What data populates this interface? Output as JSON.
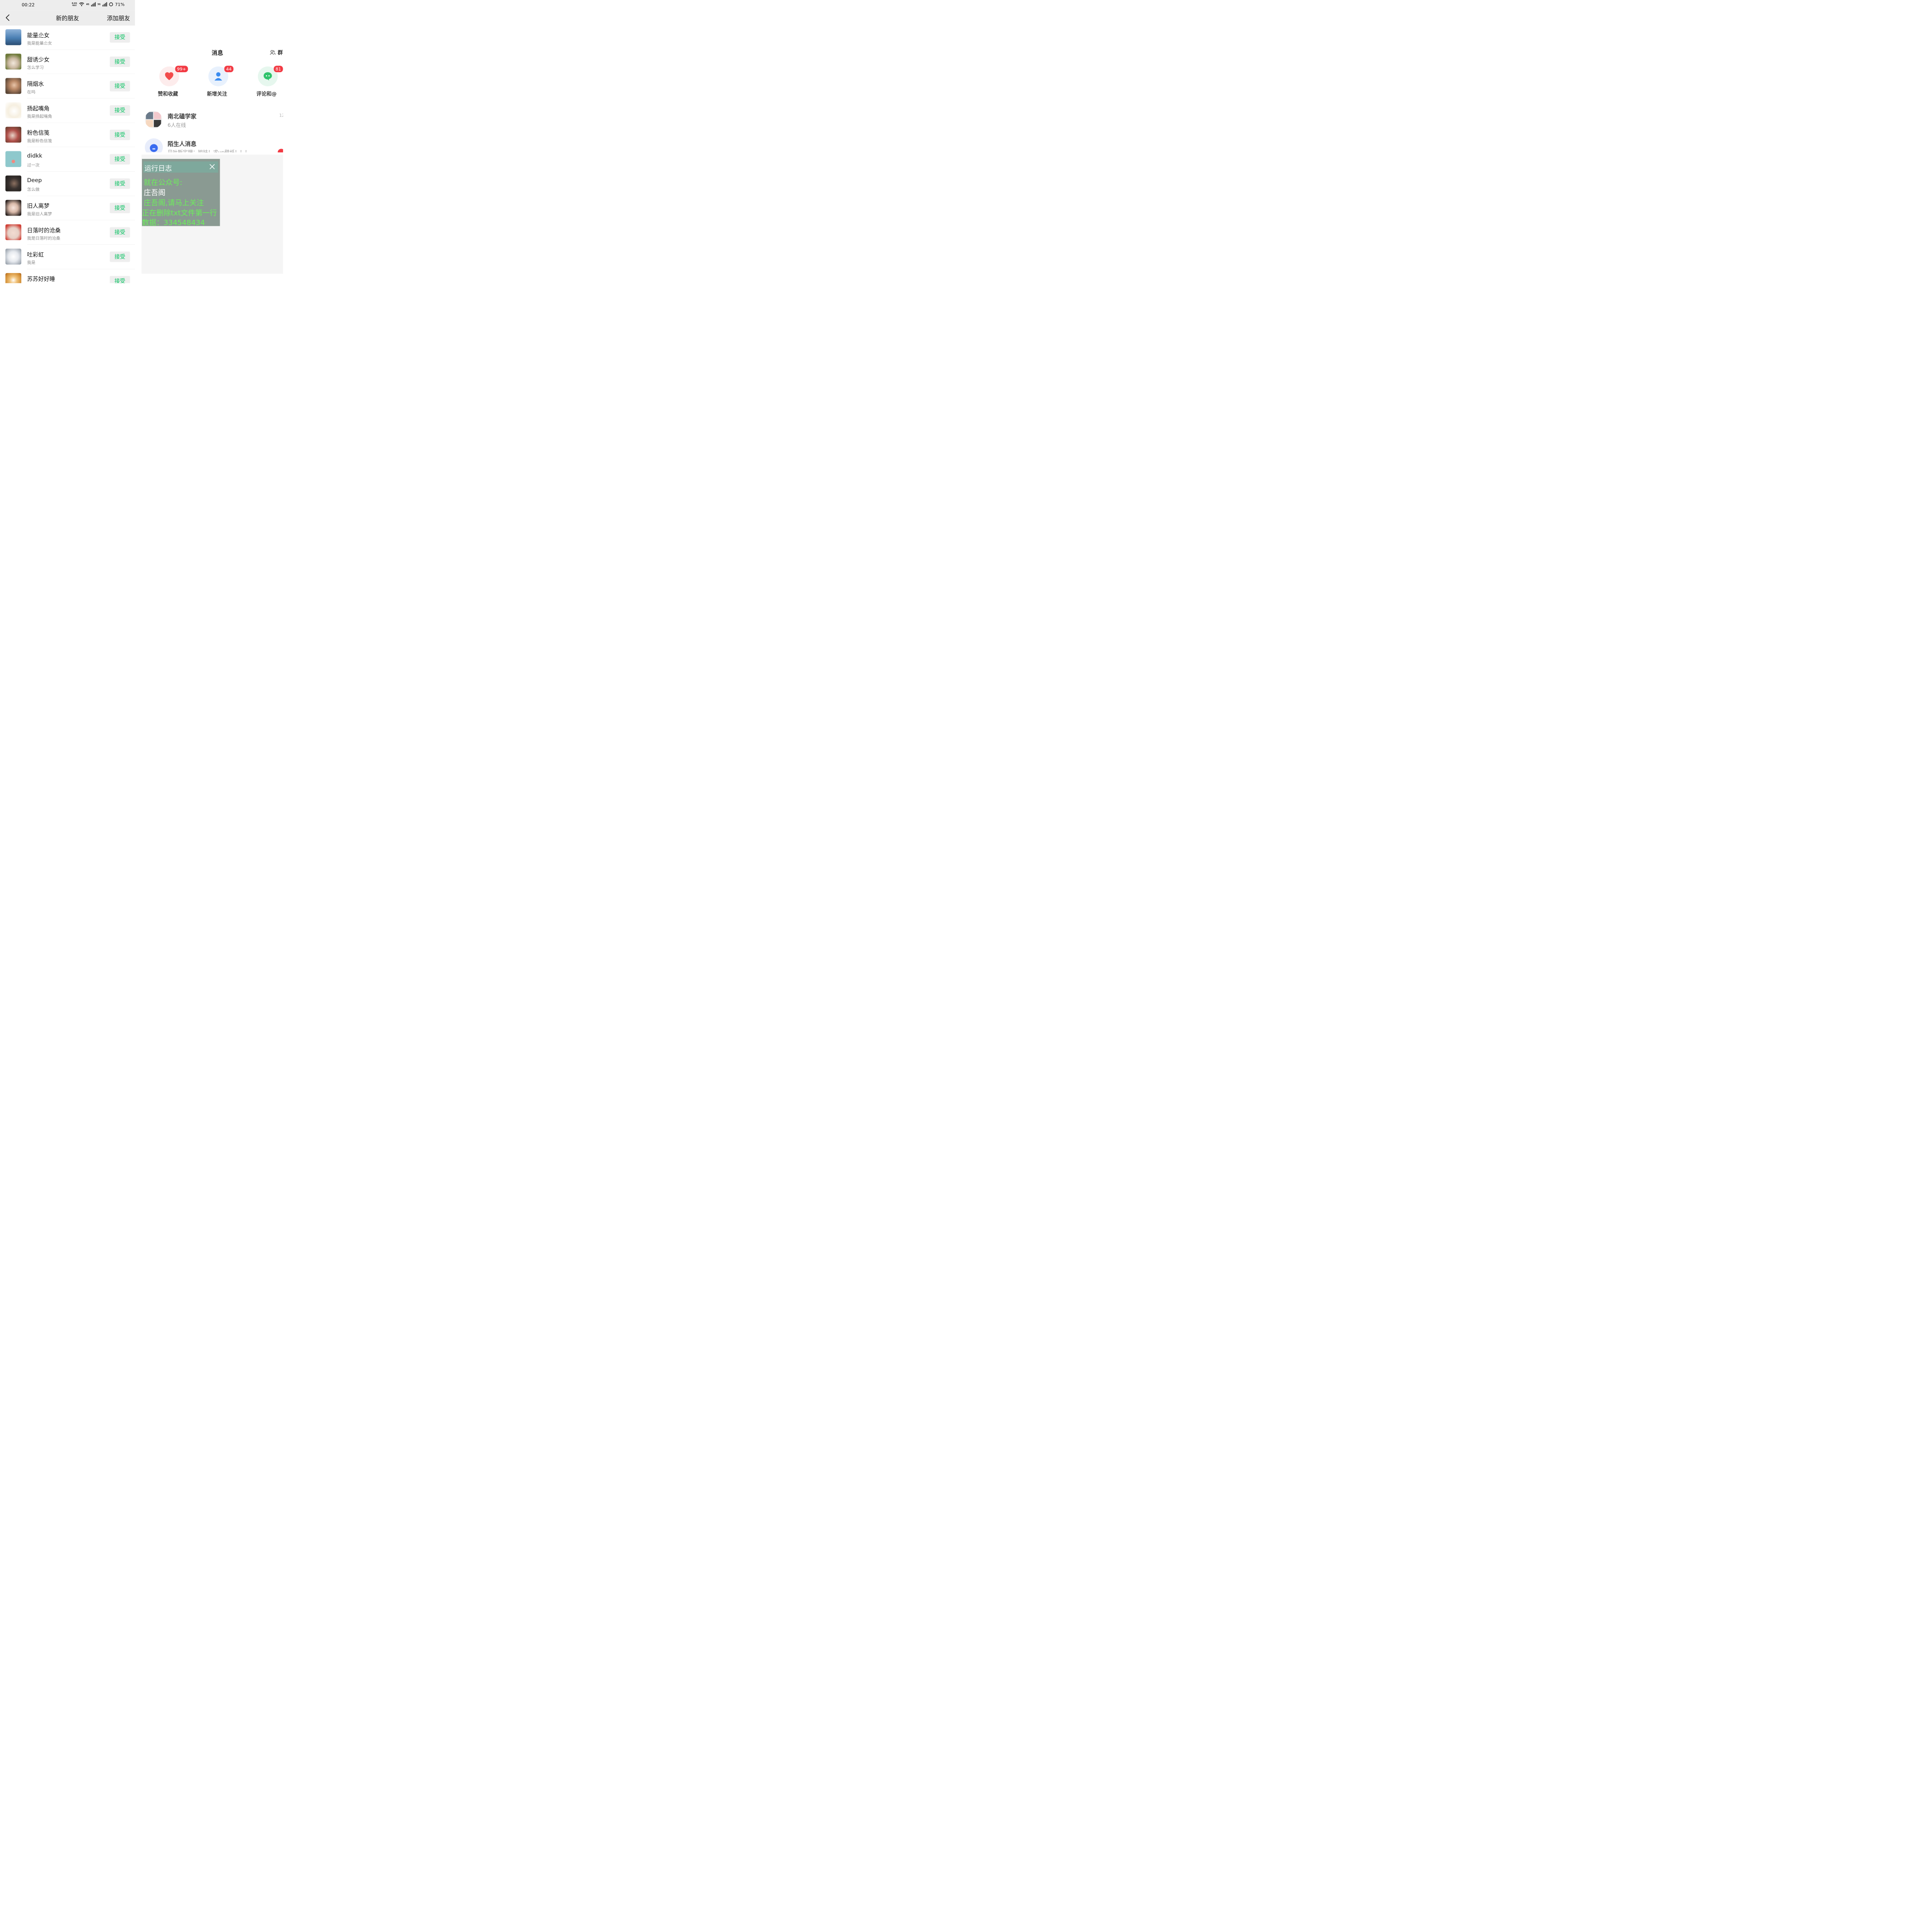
{
  "status_bar": {
    "time": "00:22",
    "net_speed_top": "0.01",
    "net_speed_bottom": "KB/S",
    "sig1": "4G",
    "sig2": "5G",
    "battery": "71%"
  },
  "header": {
    "title": "新的朋友",
    "add_label": "添加朋友"
  },
  "friend_requests": [
    {
      "name": "能量尐女",
      "sub": "我是能量尐女",
      "button": "接受",
      "avatar_color": "#4a7fb3"
    },
    {
      "name": "甜诱少女",
      "sub": "怎么学习",
      "button": "接受",
      "avatar_color": "#8a9060"
    },
    {
      "name": "隔烟水",
      "sub": "在吗",
      "button": "接受",
      "avatar_color": "#a58060"
    },
    {
      "name": "扬起嘴角",
      "sub": "我是扬起嘴角",
      "button": "接受",
      "avatar_color": "#f0e6d0"
    },
    {
      "name": "粉色信笺",
      "sub": "我是粉色信笺",
      "button": "接受",
      "avatar_color": "#b0504a"
    },
    {
      "name": "didkk",
      "sub": "过一次",
      "button": "接受",
      "avatar_color": "#8ec8cc"
    },
    {
      "name": "Deep",
      "sub": "怎么做",
      "button": "接受",
      "avatar_color": "#3a3330"
    },
    {
      "name": "旧人离梦",
      "sub": "我是旧人离梦",
      "button": "接受",
      "avatar_color": "#d8b8a8"
    },
    {
      "name": "日落时的沧桑",
      "sub": "我是日落时的沧桑",
      "button": "接受",
      "avatar_color": "#e6d0c6"
    },
    {
      "name": "吐彩虹",
      "sub": "我是",
      "button": "接受",
      "avatar_color": "#e6e9ee"
    },
    {
      "name": "苏苏好好睡",
      "sub": "",
      "button": "接受",
      "avatar_color": "#d08a30"
    }
  ],
  "messages": {
    "title": "消息",
    "group_label": "群",
    "quick": [
      {
        "label": "赞和收藏",
        "badge": "99+",
        "color": "#f24b4b",
        "bg": "#fdecec"
      },
      {
        "label": "新增关注",
        "badge": "44",
        "color": "#3a8cf0",
        "bg": "#e8f1fd"
      },
      {
        "label": "评论和@",
        "badge": "81",
        "color": "#2fc36b",
        "bg": "#e6f7ee"
      }
    ],
    "chats": [
      {
        "name": "南北磕学家",
        "sub": "6人在线",
        "time": "12"
      },
      {
        "name": "陌生人消息",
        "sub": "贝叶斯定理：姐妹！求up壁纸！！！"
      }
    ]
  },
  "log": {
    "title": "运行日志",
    "lines": [
      "就在公众号:",
      "庄吾阁",
      "庄吾阁,请马上关注",
      "正在删除txt文件第一行",
      "数据：334548434"
    ]
  }
}
